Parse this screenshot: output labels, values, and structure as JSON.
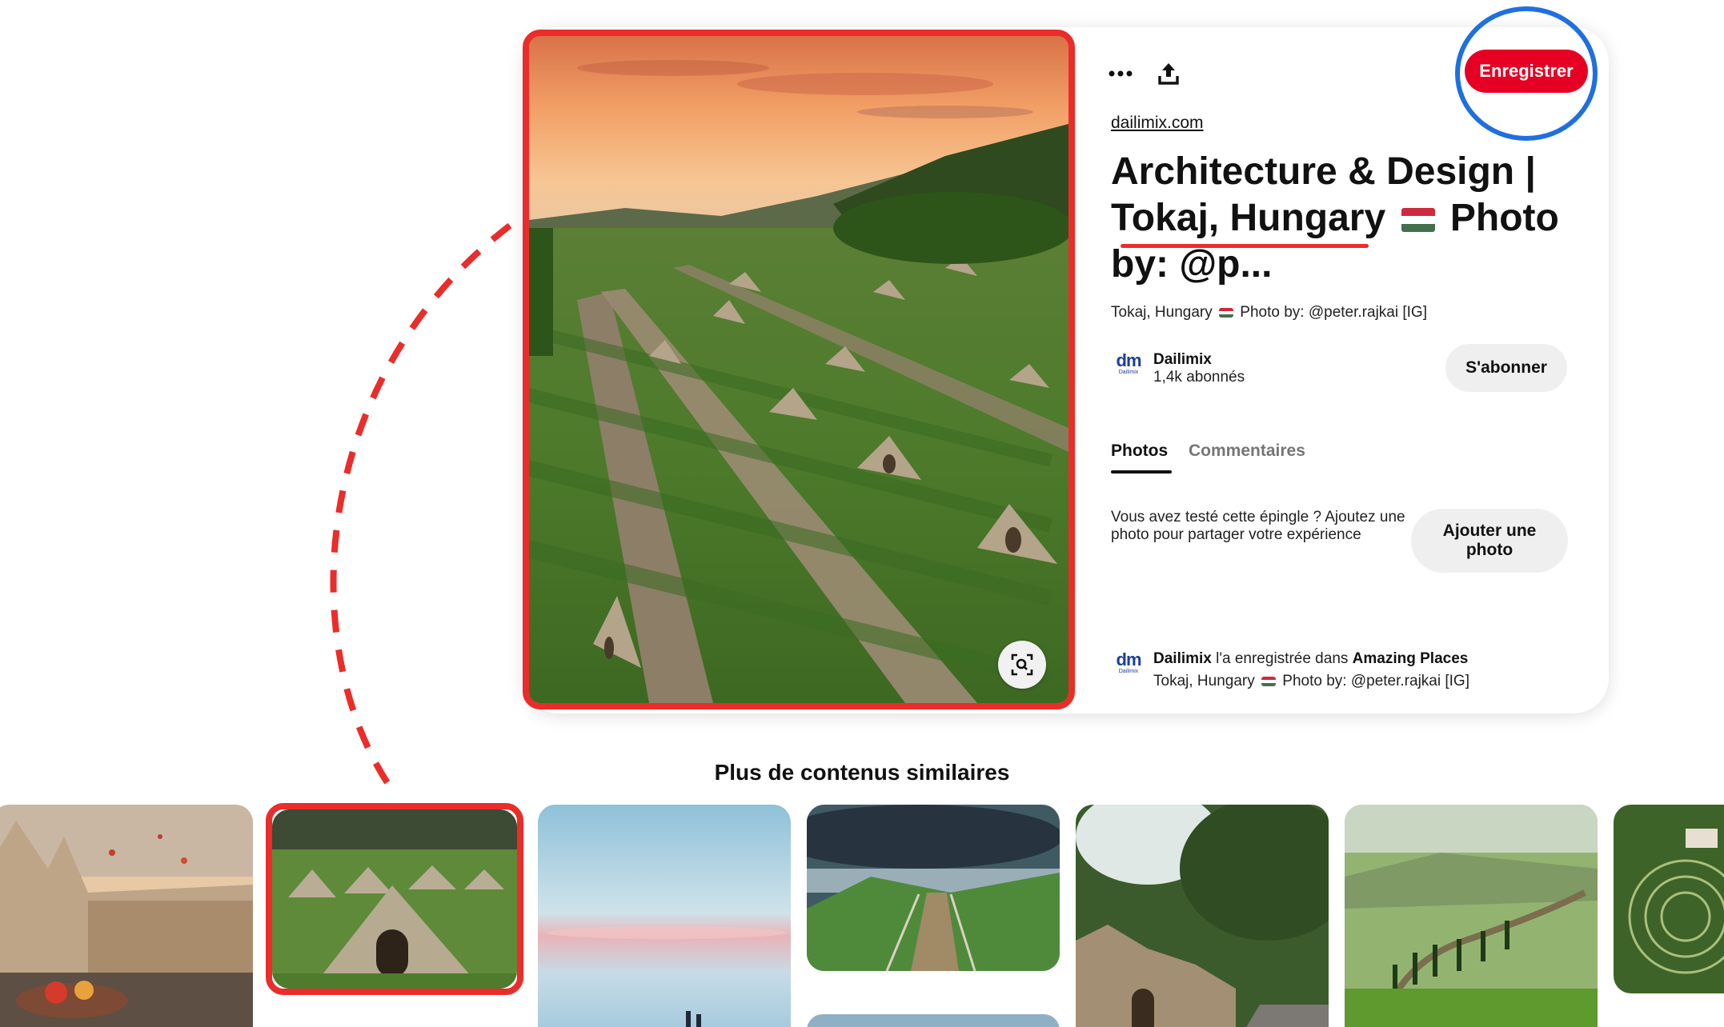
{
  "pin": {
    "source": "dailimix.com",
    "title_line1": "Architecture & Design |",
    "title_line2_a": "Tokaj, Hungary",
    "title_line2_b": "Photo",
    "title_line3": "by: @p...",
    "description_a": "Tokaj, Hungary",
    "description_b": "Photo by: @peter.rajkai [IG]",
    "save_label": "Enregistrer"
  },
  "creator": {
    "logo_mark": "dm",
    "logo_sub": "Dailimix",
    "name": "Dailimix",
    "followers": "1,4k abonnés",
    "follow_label": "S'abonner"
  },
  "tabs": {
    "photos": "Photos",
    "comments": "Commentaires"
  },
  "tried": {
    "text": "Vous avez testé cette épingle ? Ajoutez une photo pour partager votre expérience",
    "button_label": "Ajouter une photo"
  },
  "saved": {
    "user": "Dailimix",
    "middle": "l'a enregistrée dans",
    "board": "Amazing Places",
    "desc_a": "Tokaj, Hungary",
    "desc_b": "Photo by: @peter.rajkai [IG]"
  },
  "more_like_this": {
    "heading": "Plus de contenus similaires"
  },
  "icons": {
    "more": "more-dots-icon",
    "share": "share-upload-icon",
    "lens": "visual-search-icon",
    "flag": "hungary-flag-icon"
  },
  "colors": {
    "save_red": "#e60023",
    "annotation_red": "#ea2d2a",
    "annotation_blue": "#1f6fe0",
    "secondary_button": "#efefef"
  }
}
